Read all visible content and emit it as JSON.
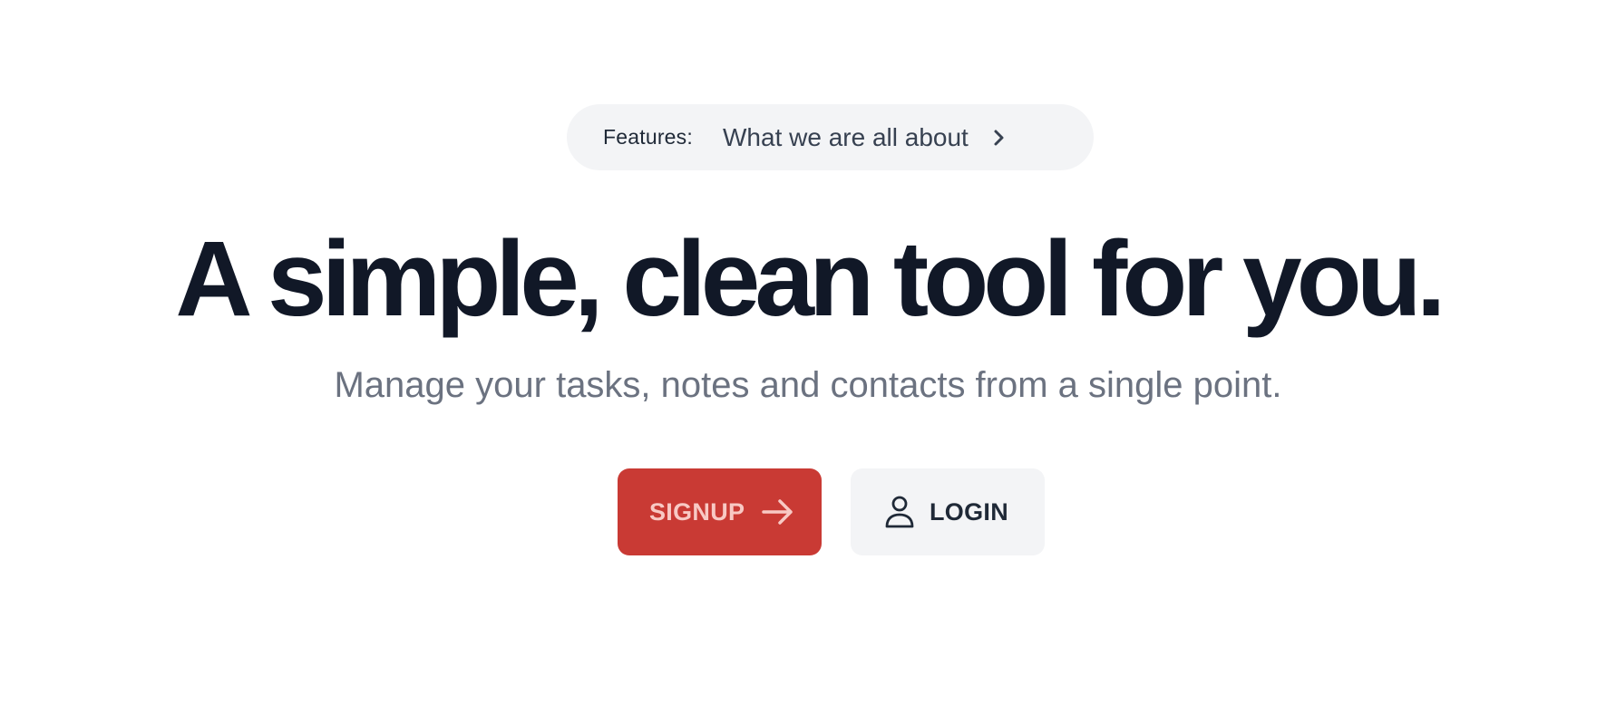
{
  "announcement": {
    "prefix": "Features:",
    "text": "What we are all about",
    "icon": "chevron-right-icon"
  },
  "hero": {
    "title": "A simple, clean tool for you.",
    "subtitle": "Manage your tasks, notes and contacts from a single point."
  },
  "actions": {
    "signup_label": "SIGNUP",
    "signup_icon": "arrow-right-icon",
    "login_label": "LOGIN",
    "login_icon": "user-icon"
  },
  "colors": {
    "primary": "#c93a34",
    "primary_text": "#f8c9c4",
    "heading": "#111827",
    "muted": "#6b7280",
    "surface": "#f3f4f6"
  }
}
